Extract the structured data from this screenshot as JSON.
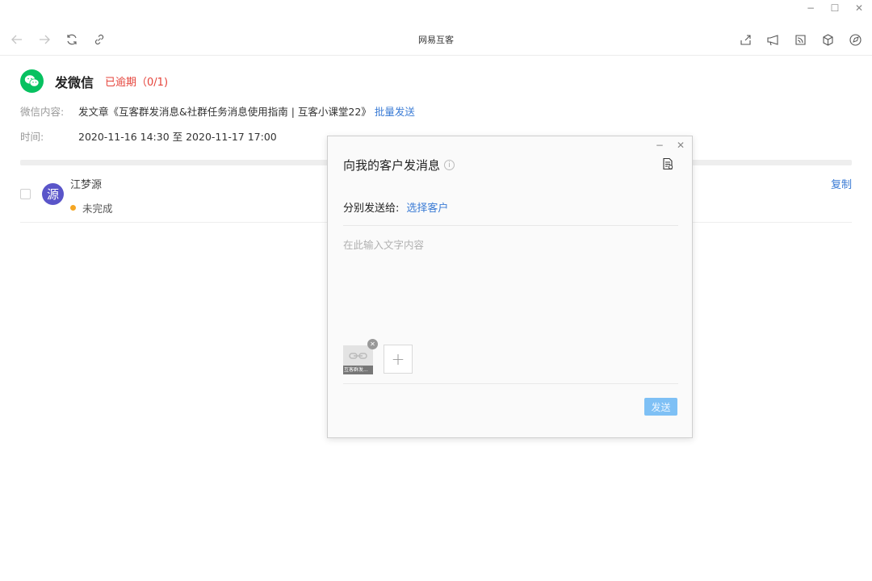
{
  "window": {
    "title": "网易互客",
    "minimize": "−",
    "maximize": "☐",
    "close": "✕"
  },
  "toolbar": {
    "nav_icons": [
      "back-arrow-icon",
      "forward-arrow-icon",
      "refresh-icon",
      "link-icon"
    ],
    "right_icons": [
      "share-icon",
      "announce-icon",
      "feed-icon",
      "cube-icon",
      "compass-icon"
    ]
  },
  "task": {
    "title": "发微信",
    "status": "已逾期（0/1)",
    "content_label": "微信内容:",
    "content_value": "发文章《互客群发消息&社群任务消息使用指南 | 互客小课堂22》",
    "batch_send": "批量发送",
    "time_label": "时间:",
    "time_value": "2020-11-16 14:30 至 2020-11-17 17:00"
  },
  "customer": {
    "avatar_char": "源",
    "name": "江梦源",
    "status": "未完成",
    "copy": "复制",
    "status_color": "#f5a623"
  },
  "dialog": {
    "minimize": "−",
    "close": "✕",
    "title": "向我的客户发消息",
    "info": "i",
    "send_to_label": "分别发送给:",
    "select_customers": "选择客户",
    "input_placeholder": "在此输入文字内容",
    "attachment_label": "互客群发...",
    "add_attachment": "+",
    "remove_attachment": "✕",
    "send_button": "发送"
  },
  "colors": {
    "wechat_green": "#07c160",
    "link_blue": "#3a7bd5",
    "overdue_red": "#e5433a",
    "avatar_purple": "#5a55c9",
    "send_button": "#7ec0f5"
  }
}
